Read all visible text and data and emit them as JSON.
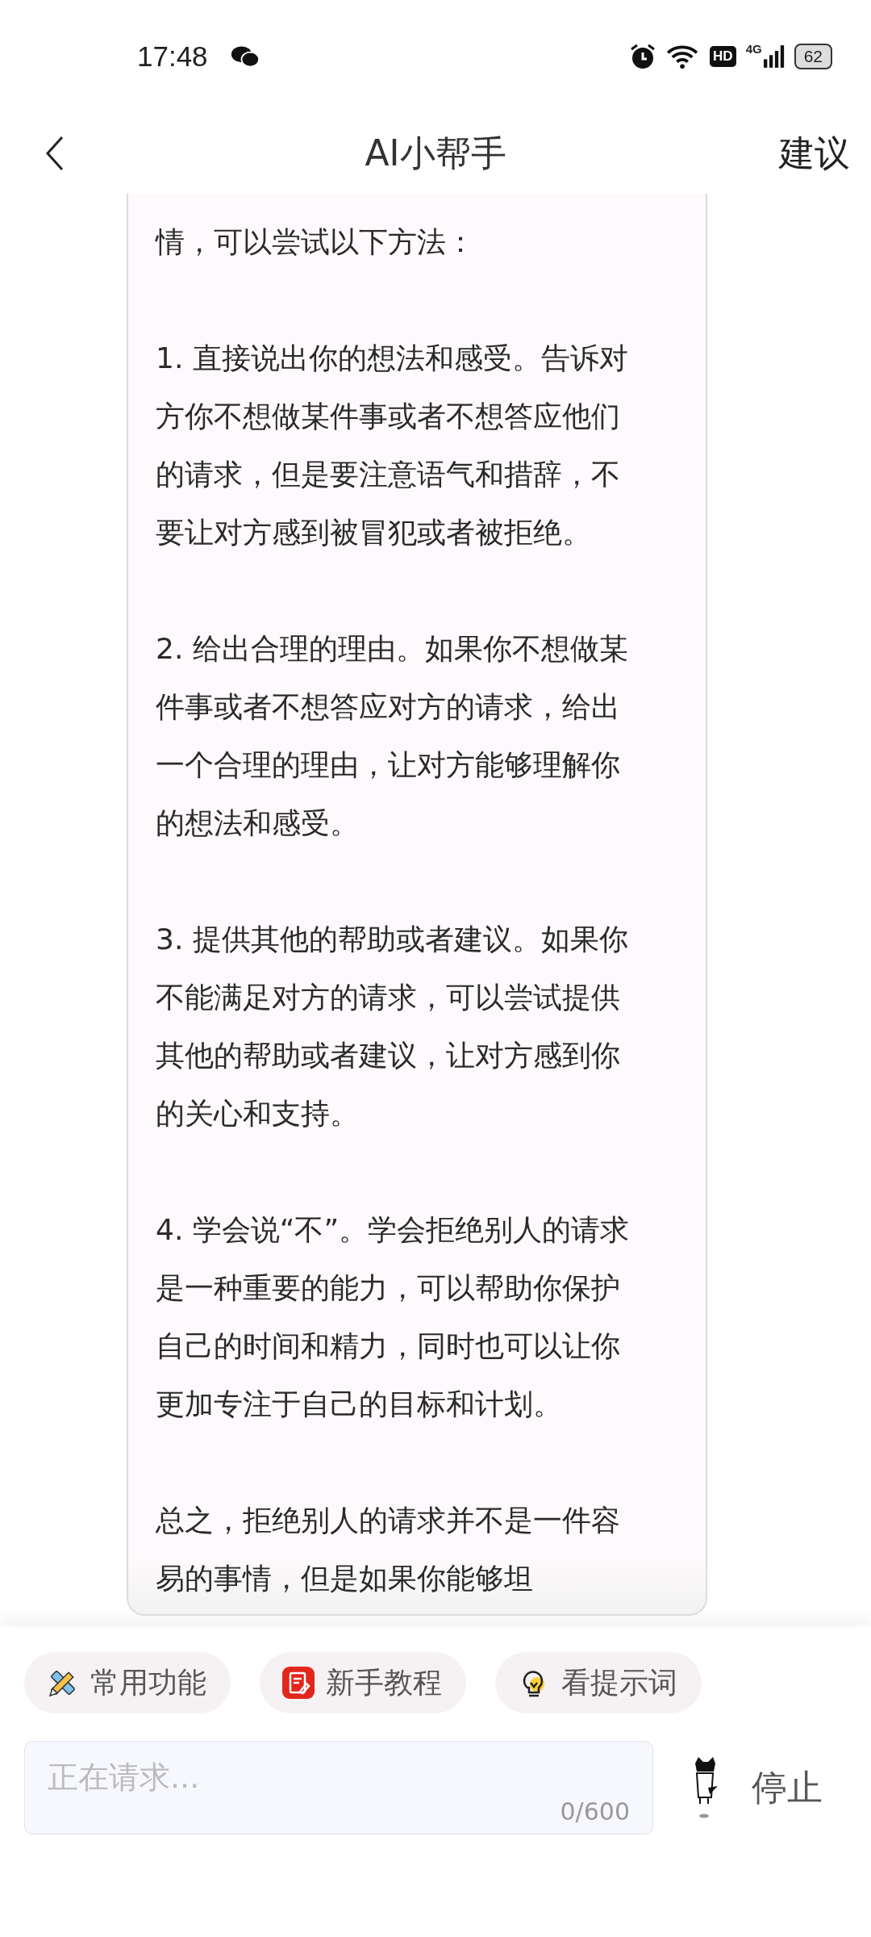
{
  "status_bar": {
    "time": "17:48",
    "hd": "HD",
    "network": "4G",
    "battery": "62"
  },
  "header": {
    "title": "AI小帮手",
    "action": "建议"
  },
  "message": {
    "paragraphs": [
      "情，可以尝试以下方法：",
      "1. 直接说出你的想法和感受。告诉对方你不想做某件事或者不想答应他们的请求，但是要注意语气和措辞，不要让对方感到被冒犯或者被拒绝。",
      "2. 给出合理的理由。如果你不想做某件事或者不想答应对方的请求，给出一个合理的理由，让对方能够理解你的想法和感受。",
      "3. 提供其他的帮助或者建议。如果你不能满足对方的请求，可以尝试提供其他的帮助或者建议，让对方感到你的关心和支持。",
      "4. 学会说“不”。学会拒绝别人的请求是一种重要的能力，可以帮助你保护自己的时间和精力，同时也可以让你更加专注于自己的目标和计划。",
      "总之，拒绝别人的请求并不是一件容易的事情，但是如果你能够坦"
    ]
  },
  "shortcuts": [
    {
      "label": "常用功能",
      "kind": "tools"
    },
    {
      "label": "新手教程",
      "kind": "tutorial"
    },
    {
      "label": "看提示词",
      "kind": "tips"
    }
  ],
  "input": {
    "placeholder": "正在请求...",
    "counter": "0/600"
  },
  "stop_button": {
    "label": "停止"
  }
}
